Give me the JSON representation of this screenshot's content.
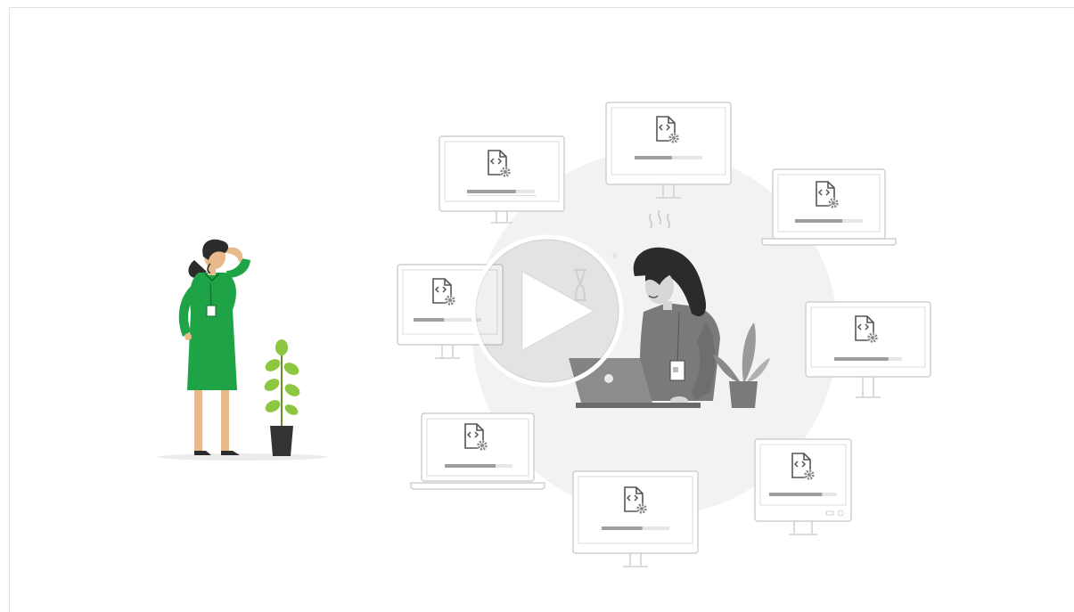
{
  "video": {
    "state": "paused",
    "play_icon": "play-icon"
  },
  "colors": {
    "accent_green": "#1ea446",
    "plant_green": "#8dc63f",
    "skin": "#e8b98b",
    "hair": "#2b2b2b",
    "monitor_stroke": "#cfcfcf",
    "progress_bar": "#9e9e9e",
    "circle_bg": "#f2f2f3",
    "gray_figure": "#7a7a7a"
  },
  "illustration": {
    "devices": [
      {
        "kind": "monitor",
        "progress": 0.72
      },
      {
        "kind": "monitor",
        "progress": 0.55
      },
      {
        "kind": "laptop",
        "progress": 0.7
      },
      {
        "kind": "monitor",
        "progress": 0.45
      },
      {
        "kind": "monitor",
        "progress": 0.8
      },
      {
        "kind": "laptop",
        "progress": 0.75
      },
      {
        "kind": "monitor",
        "progress": 0.6
      },
      {
        "kind": "desktop",
        "progress": 0.78
      }
    ],
    "device_icon": "code-file-gear-icon"
  }
}
